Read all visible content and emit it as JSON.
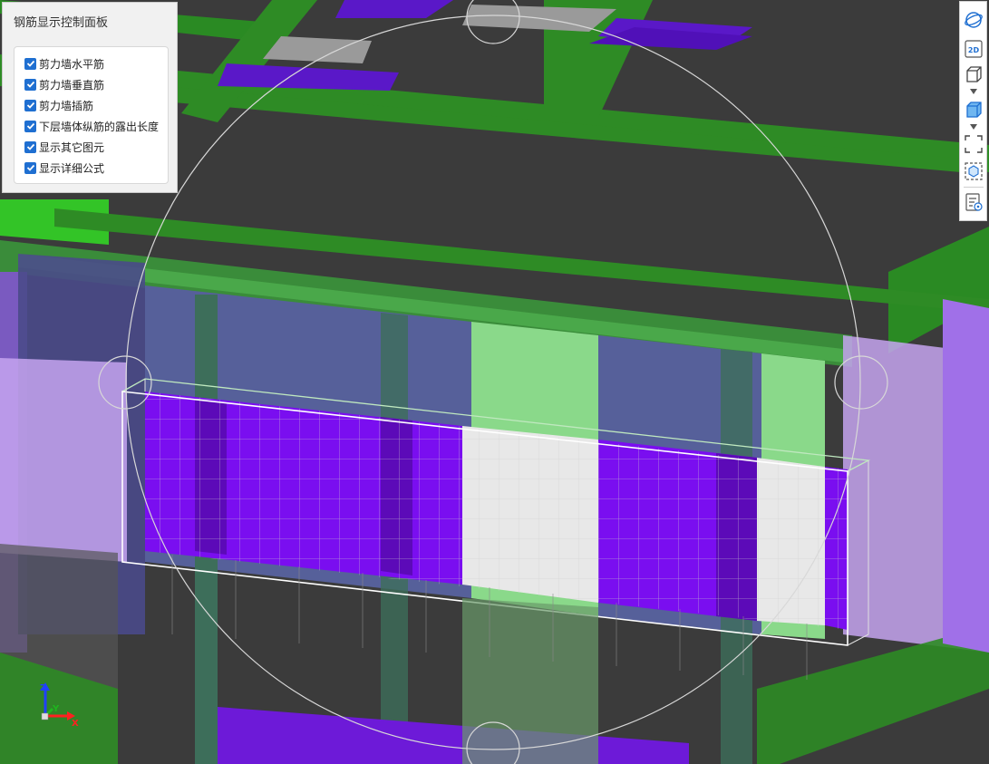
{
  "panel": {
    "title": "钢筋显示控制面板",
    "options": [
      {
        "label": "剪力墙水平筋",
        "checked": true
      },
      {
        "label": "剪力墙垂直筋",
        "checked": true
      },
      {
        "label": "剪力墙插筋",
        "checked": true
      },
      {
        "label": "下层墙体纵筋的露出长度",
        "checked": true
      },
      {
        "label": "显示其它图元",
        "checked": true
      },
      {
        "label": "显示详细公式",
        "checked": true
      }
    ]
  },
  "toolbar": {
    "items": [
      "orbit-icon",
      "2d-view-icon",
      "cube-outline-icon",
      "cube-solid-icon",
      "fit-view-icon",
      "selection-box-icon",
      "rebar-legend-icon"
    ],
    "label_2d": "2D"
  },
  "axis": {
    "z": "Z",
    "y": "Y",
    "x": "X"
  },
  "colors": {
    "background": "#3a3a3a",
    "beam_green": "#2e8b25",
    "bright_green": "#33c427",
    "rebar_purple": "#7a0ef0",
    "wall_blue": "#56609a",
    "light_green": "#8ad98a",
    "light_purple": "#c6a4f0",
    "selection_white": "#ffffff",
    "checkbox_blue": "#1f6fd1"
  }
}
